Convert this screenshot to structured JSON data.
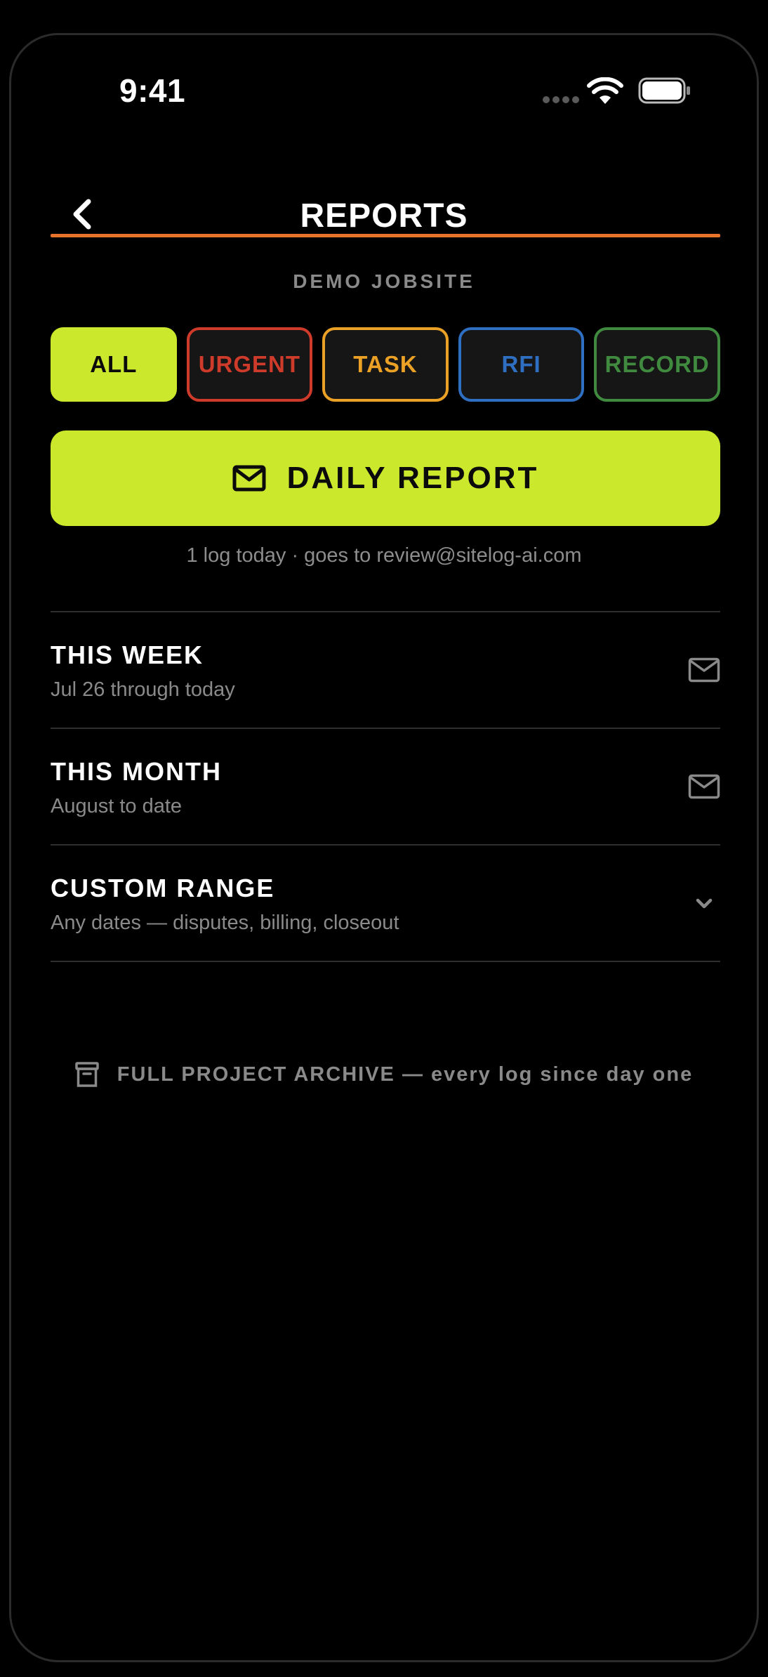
{
  "status_bar": {
    "time": "9:41"
  },
  "header": {
    "title": "REPORTS"
  },
  "jobsite": "DEMO JOBSITE",
  "filters": [
    {
      "label": "ALL",
      "selected": true,
      "color": "#cbe82d"
    },
    {
      "label": "URGENT",
      "selected": false,
      "color": "#cf3b2b"
    },
    {
      "label": "TASK",
      "selected": false,
      "color": "#eba125"
    },
    {
      "label": "RFI",
      "selected": false,
      "color": "#2f6fc2"
    },
    {
      "label": "RECORD",
      "selected": false,
      "color": "#3f8a3f"
    }
  ],
  "daily_report": {
    "label": "DAILY REPORT",
    "subtitle": "1 log today · goes to review@sitelog-ai.com",
    "color": "#cbe82d"
  },
  "reports": [
    {
      "title": "THIS WEEK",
      "subtitle": "Jul 26 through today",
      "icon": "mail-icon"
    },
    {
      "title": "THIS MONTH",
      "subtitle": "August to date",
      "icon": "mail-icon"
    },
    {
      "title": "CUSTOM RANGE",
      "subtitle": "Any dates — disputes, billing, closeout",
      "icon": "chevron-down-icon"
    }
  ],
  "archive": {
    "label": "FULL PROJECT ARCHIVE — every log since day one",
    "icon": "archive-icon"
  },
  "colors": {
    "accent_rule": "#e8732a",
    "background": "#000000"
  }
}
